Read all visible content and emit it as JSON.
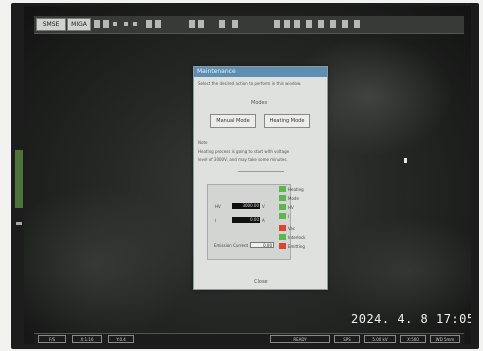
{
  "toolbar": {
    "buttons": [
      "SMSE",
      "MIGA"
    ],
    "icons": [
      "grid-icon",
      "list-icon",
      "zoom-icon",
      "crosshair-icon",
      "settings-icon",
      "export-icon",
      "pointer-icon",
      "ruler-icon",
      "measure-icon",
      "layers-icon",
      "table-icon",
      "panel-icon",
      "window-icon"
    ]
  },
  "dialog": {
    "title": "Maintenance",
    "intro_text": "Select the desired action to perform in this window.",
    "mode_label": "Modes",
    "buttons": [
      "Manual Mode",
      "Heating Mode"
    ],
    "notes_label": "Note",
    "notes_lines": [
      "Heating process is going to start with voltage",
      "level of 3000V, and may take some minutes."
    ],
    "readouts": [
      {
        "label": "HV",
        "value": "3000.00",
        "unit": "V"
      },
      {
        "label": "I",
        "value": "0.00",
        "unit": "A"
      },
      {
        "label": "Emission Current",
        "value": "0.00"
      }
    ],
    "indicators": [
      {
        "label": "Heating",
        "color": "#5cb84a"
      },
      {
        "label": "Mode",
        "color": "#5cb84a"
      },
      {
        "label": "HV",
        "color": "#5cb84a"
      },
      {
        "label": "I",
        "color": "#5cb84a"
      },
      {
        "label": "Vac",
        "color": "#e0452c"
      },
      {
        "label": "Interlock",
        "color": "#5cb84a"
      },
      {
        "label": "Emitting",
        "color": "#e0452c"
      }
    ],
    "close_label": "Close"
  },
  "timestamp": {
    "date": "2024. 4. 8",
    "time": "17:05"
  },
  "statusbar": {
    "left_items": [
      "F/S",
      "X:1.16",
      "Y:0.4"
    ],
    "right_items": [
      "READY",
      "SPS",
      "5.00 kV",
      "X:500",
      "WD 5mm"
    ]
  },
  "colors": {
    "screen": "#262826",
    "dialog": "#dfe1de",
    "titlebar": "#5d8fb3",
    "on": "#5cb84a",
    "off": "#e0452c"
  }
}
